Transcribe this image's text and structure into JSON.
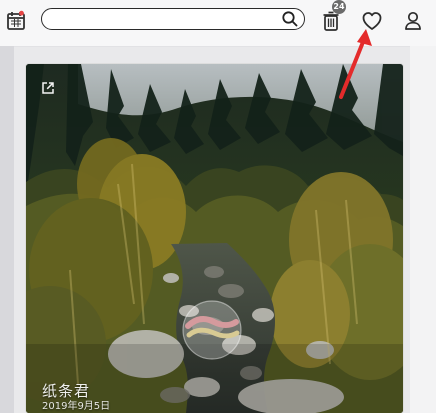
{
  "header": {
    "trash_badge_count": "24",
    "search": {
      "placeholder": "",
      "value": ""
    },
    "icons": {
      "calendar": "calendar-icon",
      "search": "search-icon",
      "trash": "trash-icon",
      "heart": "heart-icon",
      "user": "user-icon"
    }
  },
  "card": {
    "title": "纸条君",
    "date": "2019年9月5日",
    "icons": {
      "open": "external-open-icon",
      "center": "play-overlay-icon"
    }
  },
  "colors": {
    "annotation_arrow": "#e42b2b",
    "badge": "#6b6b6b",
    "accent": "#d8b45a"
  }
}
